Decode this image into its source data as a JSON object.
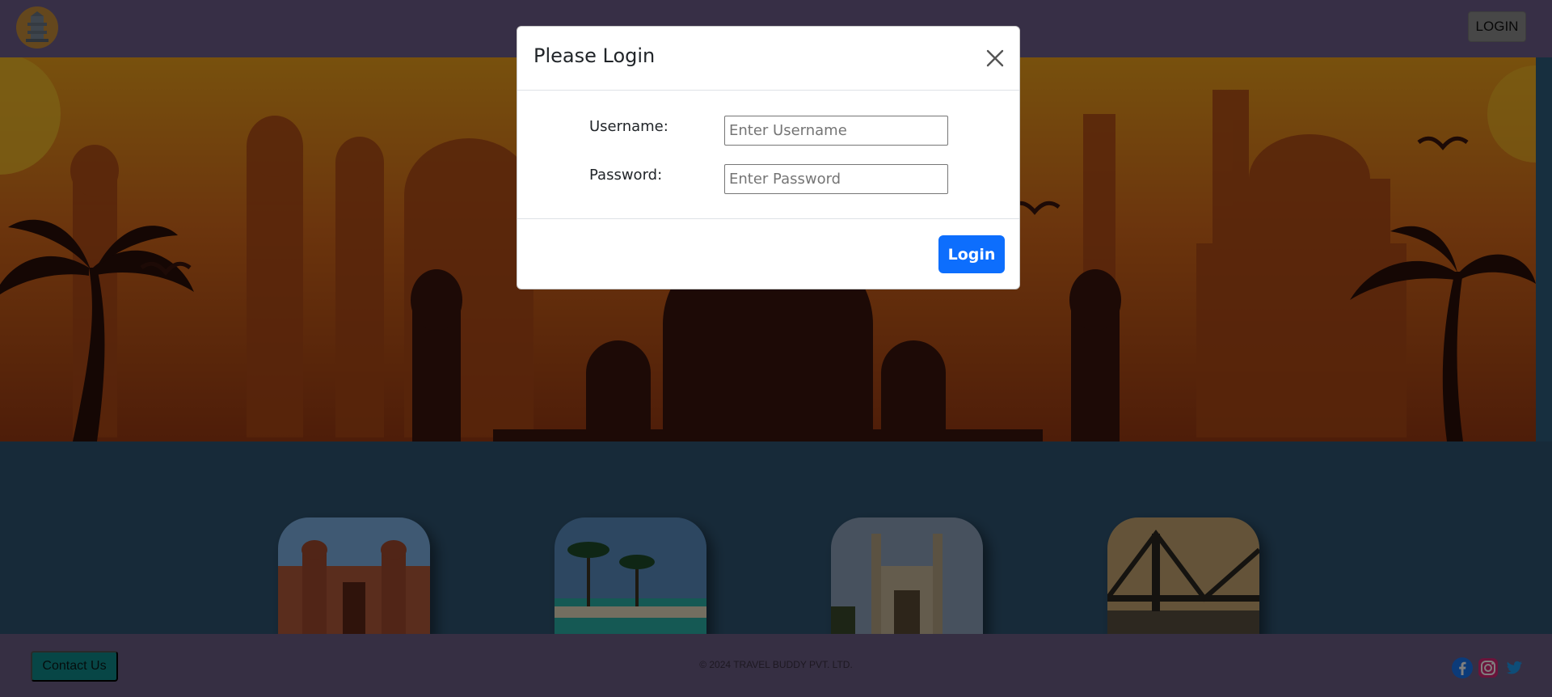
{
  "header": {
    "logo_icon": "temple-logo-icon",
    "login_label": "LOGIN"
  },
  "hero": {
    "illustration": "indian-monuments-skyline-silhouette",
    "colors": {
      "sky_top": "#f0a21a",
      "sky_bottom": "#9c3a12",
      "silhouette": "#3a140c"
    }
  },
  "destinations": [
    {
      "icon": "red-fort-image"
    },
    {
      "icon": "tropical-beach-image"
    },
    {
      "icon": "charminar-image"
    },
    {
      "icon": "howrah-bridge-image"
    }
  ],
  "footer": {
    "contact_label": "Contact Us",
    "copyright": "© 2024 TRAVEL BUDDY PVT. LTD.",
    "social_icons": [
      "facebook-icon",
      "instagram-icon",
      "twitter-icon"
    ]
  },
  "modal": {
    "title": "Please Login",
    "close_icon": "close-icon",
    "username_label": "Username:",
    "username_placeholder": "Enter Username",
    "username_value": "",
    "password_label": "Password:",
    "password_placeholder": "Enter Password",
    "password_value": "",
    "submit_label": "Login",
    "accent_color": "#0d6efd"
  }
}
